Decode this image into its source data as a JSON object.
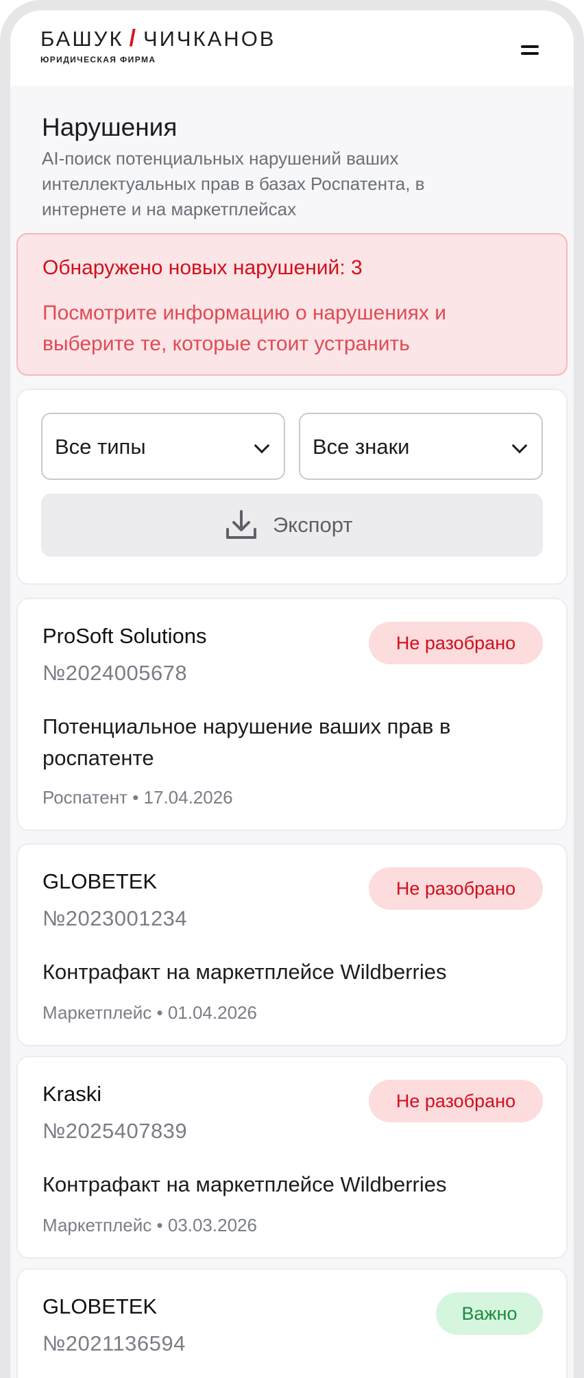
{
  "header": {
    "logo_left": "БАШУК",
    "logo_slash": "/",
    "logo_right": "ЧИЧКАНОВ",
    "logo_sub": "ЮРИДИЧЕСКАЯ ФИРМА",
    "menu_icon": "hamburger-icon"
  },
  "page": {
    "title": "Нарушения",
    "subtitle": "AI-поиск потенциальных нарушений ваших интеллектуальных прав в базах Роспатента, в интернете и на маркетплейсах"
  },
  "alert": {
    "title": "Обнаружено новых нарушений: 3",
    "text": "Посмотрите информацию о нарушениях и выберите те, которые стоит устранить"
  },
  "filters": {
    "type_select": "Все типы",
    "mark_select": "Все знаки",
    "export_label": "Экспорт",
    "export_icon": "download-icon"
  },
  "colors": {
    "accent_red": "#d0101c",
    "alert_bg": "#fce5e6",
    "badge_green_text": "#1d8a3c"
  },
  "violations": [
    {
      "title": "ProSoft Solutions",
      "number": "№2024005678",
      "status": "Не разобрано",
      "description": "Потенциальное нарушение ваших прав в роспатенте",
      "meta": "Роспатент • 17.04.2026"
    },
    {
      "title": "GLOBETEK",
      "number": "№2023001234",
      "status": "Не разобрано",
      "description": "Контрафакт на маркетплейсе Wildberries",
      "meta": "Маркетплейс • 01.04.2026"
    },
    {
      "title": "Kraski",
      "number": "№2025407839",
      "status": "Не разобрано",
      "description": "Контрафакт на маркетплейсе Wildberries",
      "meta": "Маркетплейс • 03.03.2026"
    },
    {
      "title": "GLOBETEK",
      "number": "№2021136594",
      "status": "Важно"
    }
  ]
}
